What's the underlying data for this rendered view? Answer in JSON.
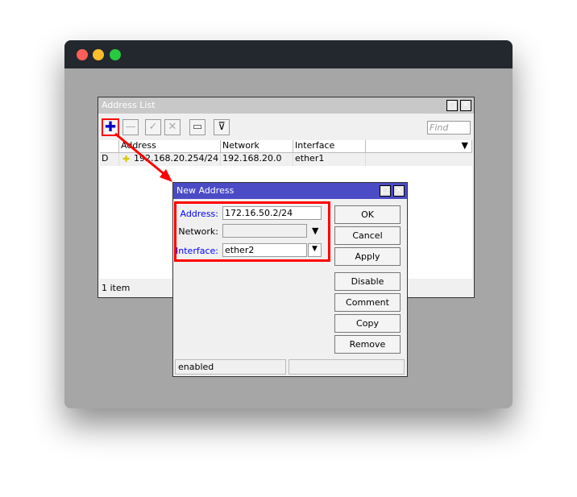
{
  "address_list": {
    "title": "Address List",
    "find_placeholder": "Find",
    "columns": [
      "",
      "Address",
      "Network",
      "Interface"
    ],
    "rows": [
      {
        "flag": "D",
        "address": "192.168.20.254/24",
        "network": "192.168.20.0",
        "interface": "ether1"
      }
    ],
    "status": "1 item"
  },
  "new_address": {
    "title": "New Address",
    "address_label": "Address:",
    "address_value": "172.16.50.2/24",
    "network_label": "Network:",
    "network_value": "",
    "interface_label": "Interface:",
    "interface_value": "ether2",
    "buttons": [
      "OK",
      "Cancel",
      "Apply",
      "Disable",
      "Comment",
      "Copy",
      "Remove"
    ],
    "status": "enabled"
  },
  "colors": {
    "highlight": "#ff0000",
    "dialog_title": "#4b4bc6",
    "link_label": "#0000ff"
  }
}
